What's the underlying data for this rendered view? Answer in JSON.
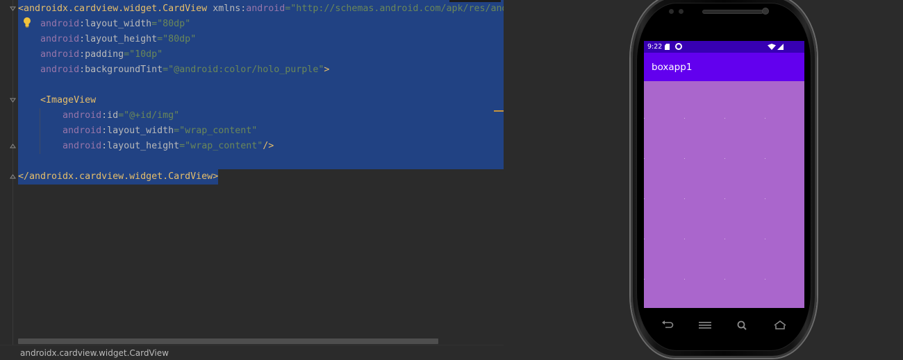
{
  "editor": {
    "lines": [
      {
        "indent": "",
        "parts": [
          {
            "t": "tag",
            "v": "<androidx.cardview.widget.CardView "
          },
          {
            "t": "attr",
            "v": "xmlns:"
          },
          {
            "t": "attr-ns",
            "v": "android"
          },
          {
            "t": "str",
            "v": "=\"http://schemas.android.com/apk/res/andr"
          }
        ]
      },
      {
        "indent": "    ",
        "parts": [
          {
            "t": "attr-ns",
            "v": "android"
          },
          {
            "t": "attr",
            "v": ":layout_width"
          },
          {
            "t": "str",
            "v": "=\"80dp\""
          }
        ]
      },
      {
        "indent": "    ",
        "parts": [
          {
            "t": "attr-ns",
            "v": "android"
          },
          {
            "t": "attr",
            "v": ":layout_height"
          },
          {
            "t": "str",
            "v": "=\"80dp\""
          }
        ]
      },
      {
        "indent": "    ",
        "parts": [
          {
            "t": "attr-ns",
            "v": "android"
          },
          {
            "t": "attr",
            "v": ":padding"
          },
          {
            "t": "str",
            "v": "=\"10dp\""
          }
        ]
      },
      {
        "indent": "    ",
        "parts": [
          {
            "t": "attr-ns",
            "v": "android"
          },
          {
            "t": "attr",
            "v": ":backgroundTint"
          },
          {
            "t": "str",
            "v": "=\"@android:color/holo_purple\""
          },
          {
            "t": "tag",
            "v": ">"
          }
        ]
      },
      {
        "indent": "",
        "parts": []
      },
      {
        "indent": "    ",
        "parts": [
          {
            "t": "tag",
            "v": "<ImageView"
          }
        ]
      },
      {
        "indent": "        ",
        "parts": [
          {
            "t": "attr-ns",
            "v": "android"
          },
          {
            "t": "attr",
            "v": ":id"
          },
          {
            "t": "str",
            "v": "=\"@+id/img\""
          }
        ]
      },
      {
        "indent": "        ",
        "parts": [
          {
            "t": "attr-ns",
            "v": "android"
          },
          {
            "t": "attr",
            "v": ":layout_width"
          },
          {
            "t": "str",
            "v": "=\"wrap_content\""
          }
        ]
      },
      {
        "indent": "        ",
        "parts": [
          {
            "t": "attr-ns",
            "v": "android"
          },
          {
            "t": "attr",
            "v": ":layout_height"
          },
          {
            "t": "str",
            "v": "=\"wrap_content\""
          },
          {
            "t": "tag",
            "v": "/>"
          }
        ]
      },
      {
        "indent": "",
        "parts": []
      },
      {
        "indent": "",
        "parts": [
          {
            "t": "tag",
            "v": "</androidx.cardview.widget.CardView>"
          }
        ]
      }
    ],
    "breadcrumb": "androidx.cardview.widget.CardView"
  },
  "preview": {
    "status_time": "9:22",
    "app_title": "boxapp1",
    "icons": [
      "sd-card-icon",
      "gear-icon",
      "wifi-icon",
      "signal-icon",
      "back-icon",
      "menu-icon",
      "search-icon",
      "home-icon"
    ]
  },
  "colors": {
    "editor_bg": "#2b2b2b",
    "selection": "#214283",
    "tag": "#e8bf6a",
    "attr_ns": "#9876aa",
    "string": "#6a8759",
    "status_bar": "#3700b3",
    "app_bar": "#6200ee",
    "holo_purple": "#aa66cc"
  }
}
